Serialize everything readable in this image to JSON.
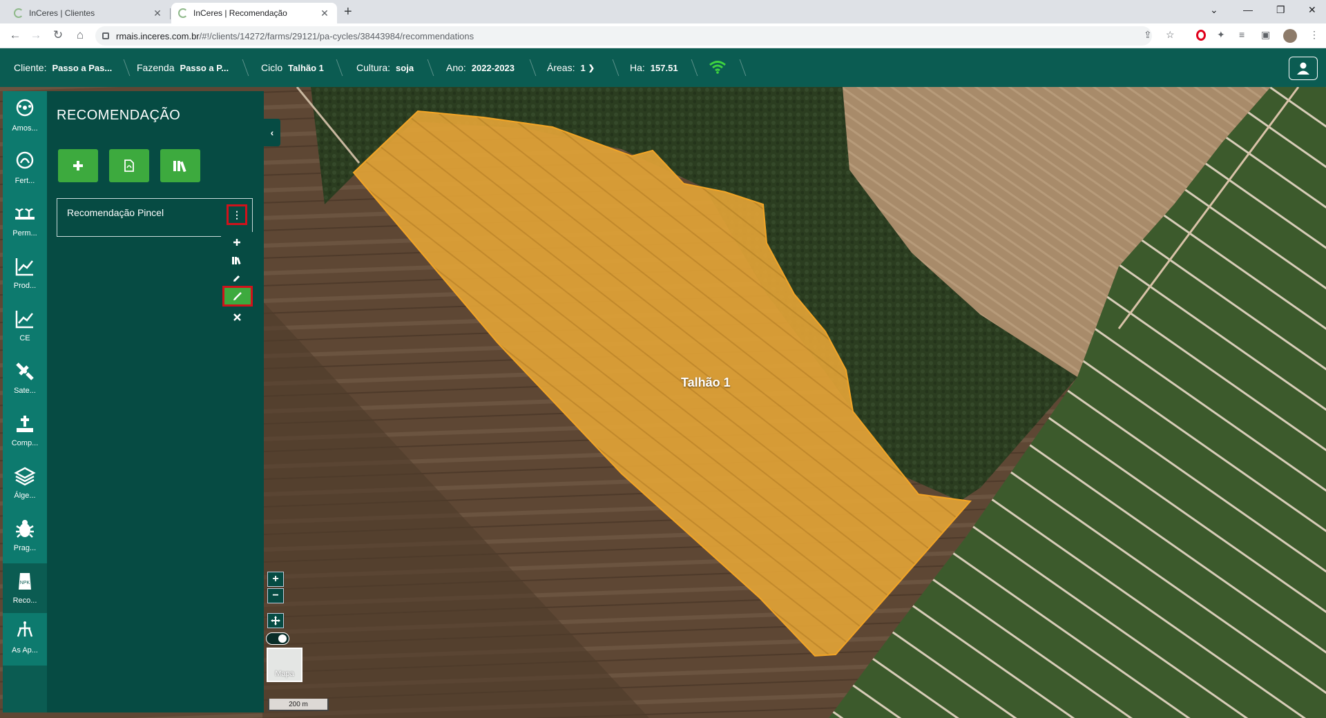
{
  "browser": {
    "tabs": [
      {
        "title": "InCeres | Clientes",
        "close": "✕"
      },
      {
        "title": "InCeres | Recomendação",
        "close": "✕"
      }
    ],
    "new_tab": "+",
    "url_host": "rmais.inceres.com.br",
    "url_path": "/#!/clients/14272/farms/29121/pa-cycles/38443984/recommendations"
  },
  "header": {
    "cliente_label": "Cliente:",
    "cliente_value": "Passo a Pas...",
    "fazenda_label": "Fazenda",
    "fazenda_value": "Passo a P...",
    "ciclo_label": "Ciclo",
    "ciclo_value": "Talhão 1",
    "cultura_label": "Cultura:",
    "cultura_value": "soja",
    "ano_label": "Ano:",
    "ano_value": "2022-2023",
    "areas_label": "Áreas:",
    "areas_value": "1",
    "ha_label": "Ha:",
    "ha_value": "157.51"
  },
  "rail": {
    "items": [
      {
        "label": "Amos..."
      },
      {
        "label": "Fert..."
      },
      {
        "label": "Perm..."
      },
      {
        "label": "Prod..."
      },
      {
        "label": "CE"
      },
      {
        "label": "Sate..."
      },
      {
        "label": "Comp..."
      },
      {
        "label": "Álge..."
      },
      {
        "label": "Prag..."
      },
      {
        "label": "Reco..."
      },
      {
        "label": "As Ap..."
      }
    ]
  },
  "panel": {
    "title": "RECOMENDAÇÃO",
    "recommendation_name": "Recomendação Pincel"
  },
  "map": {
    "field_label": "Talhão 1",
    "basemap_label": "Mapa",
    "scale_label": "200 m"
  },
  "colors": {
    "header_bg": "#0b5c52",
    "panel_bg": "#064b43",
    "rail_bg": "#0d7a6e",
    "button_green": "#3daa3e",
    "highlight_red": "#d0121b",
    "field_fill": "#e8a93a"
  }
}
